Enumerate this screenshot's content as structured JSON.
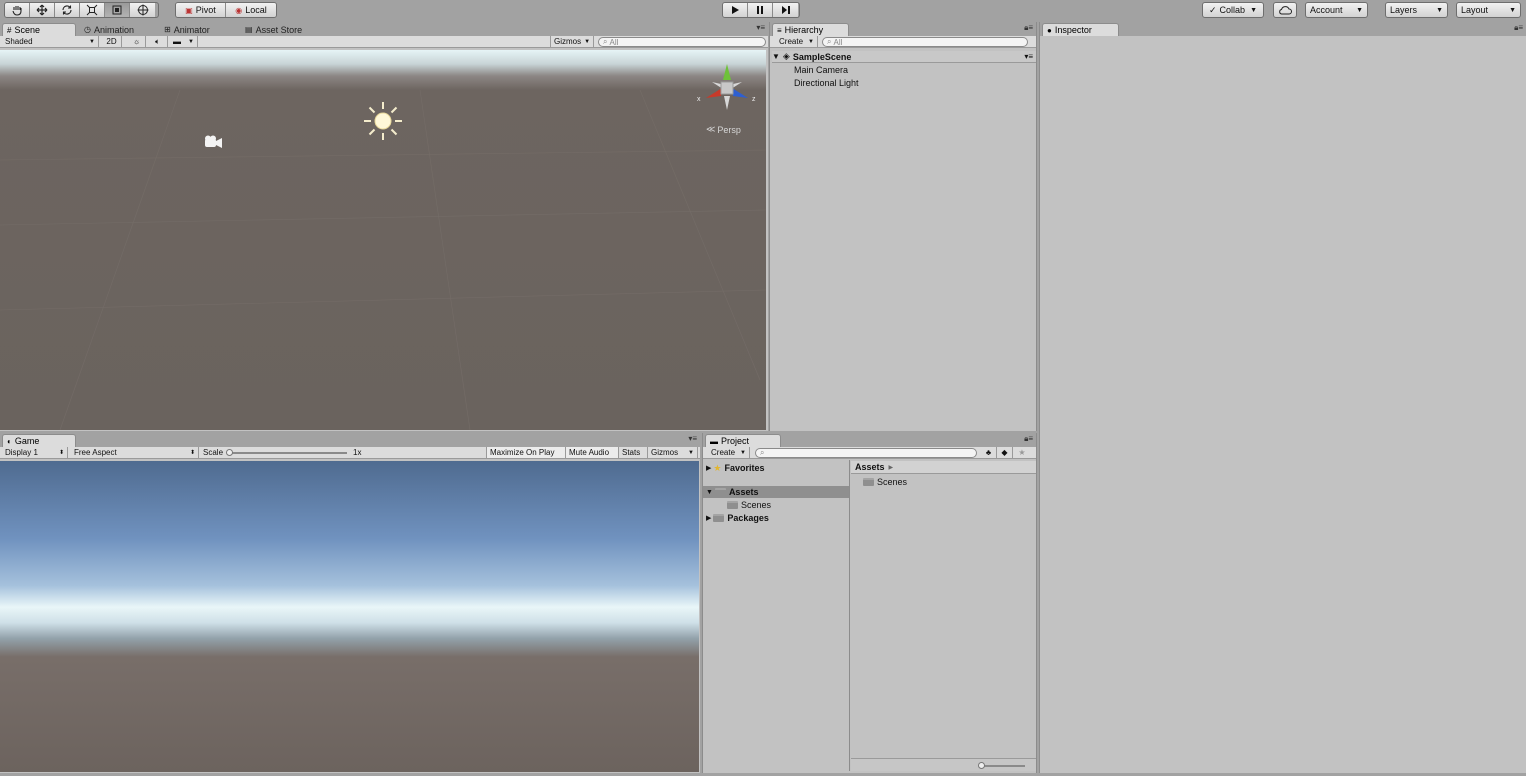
{
  "toolbar": {
    "pivot_label": "Pivot",
    "local_label": "Local",
    "collab_label": "Collab",
    "account_label": "Account",
    "layers_label": "Layers",
    "layout_label": "Layout"
  },
  "scene": {
    "tabs": [
      "Scene",
      "Animation",
      "Animator",
      "Asset Store"
    ],
    "shading_mode": "Shaded",
    "mode_2d": "2D",
    "gizmos_label": "Gizmos",
    "search_placeholder": "All",
    "persp_label": "Persp",
    "axis_x": "x",
    "axis_z": "z"
  },
  "hierarchy": {
    "tab": "Hierarchy",
    "create_label": "Create",
    "search_placeholder": "All",
    "scene_name": "SampleScene",
    "items": [
      "Main Camera",
      "Directional Light"
    ]
  },
  "inspector": {
    "tab": "Inspector"
  },
  "game": {
    "tab": "Game",
    "display": "Display 1",
    "aspect": "Free Aspect",
    "scale_label": "Scale",
    "scale_value": "1x",
    "maximize_label": "Maximize On Play",
    "mute_label": "Mute Audio",
    "stats_label": "Stats",
    "gizmos_label": "Gizmos"
  },
  "project": {
    "tab": "Project",
    "create_label": "Create",
    "tree": {
      "favorites": "Favorites",
      "assets": "Assets",
      "scenes": "Scenes",
      "packages": "Packages"
    },
    "breadcrumb": "Assets",
    "content_items": [
      "Scenes"
    ]
  },
  "colors": {
    "background": "#a2a2a2",
    "panel": "#c2c2c2",
    "selection": "#8f8f8f",
    "axis_y": "#6ec23a",
    "axis_x": "#c63a2a",
    "axis_z": "#2e5fd0"
  }
}
